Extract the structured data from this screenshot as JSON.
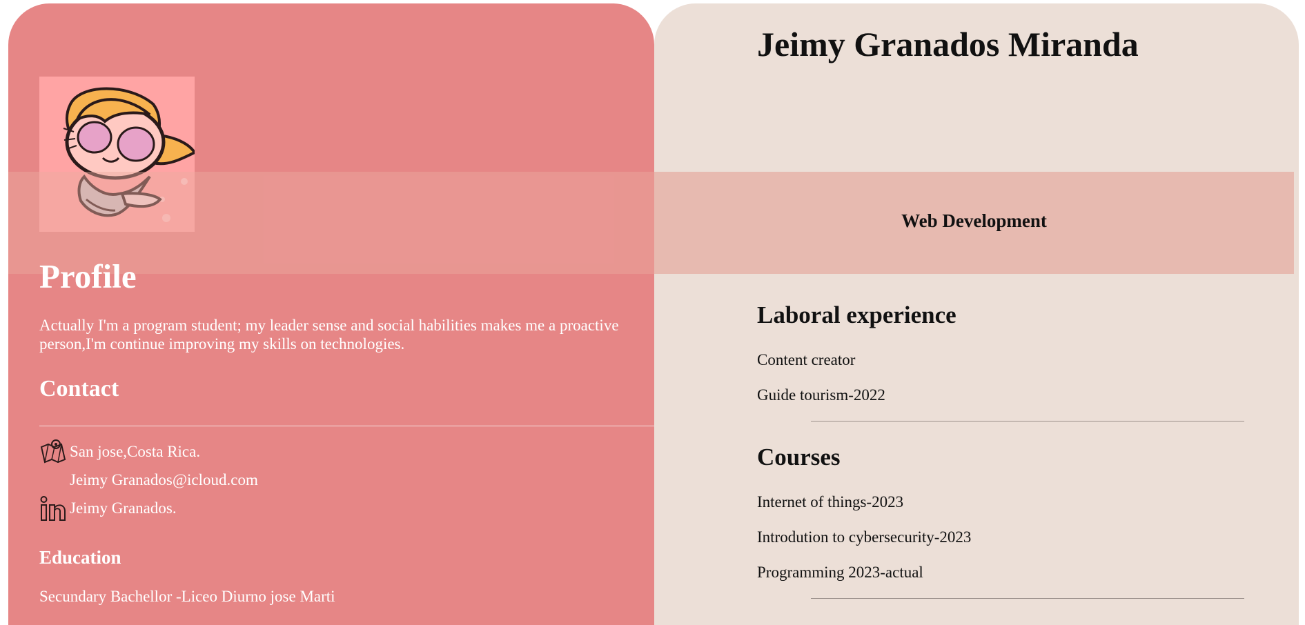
{
  "left": {
    "profile_title": "Profile",
    "profile_text": "Actually I'm a program student; my leader sense and social habilities makes me a proactive person,I'm continue improving my skills on technologies.",
    "contact_title": "Contact",
    "contact": [
      {
        "icon": "map-icon",
        "text": "San jose,Costa Rica."
      },
      {
        "icon": "",
        "text": "Jeimy Granados@icloud.com"
      },
      {
        "icon": "linkedin-icon",
        "text": "Jeimy Granados."
      }
    ],
    "education_title": "Education",
    "education_text": "Secundary Bachellor -Liceo Diurno jose Marti"
  },
  "right": {
    "name": "Jeimy Granados Miranda",
    "banner": "Web Development",
    "experience_title": "Laboral experience",
    "experience": [
      "Content creator",
      "Guide tourism-2022"
    ],
    "courses_title": "Courses",
    "courses": [
      "Internet of things-2023",
      "Introdution to cybersecurity-2023",
      "Programming 2023-actual"
    ]
  },
  "colors": {
    "left_panel": "#e68686",
    "right_panel": "#ecdfd7",
    "banner": "#e7bab0",
    "avatar_bg": "#ffa4a4"
  }
}
